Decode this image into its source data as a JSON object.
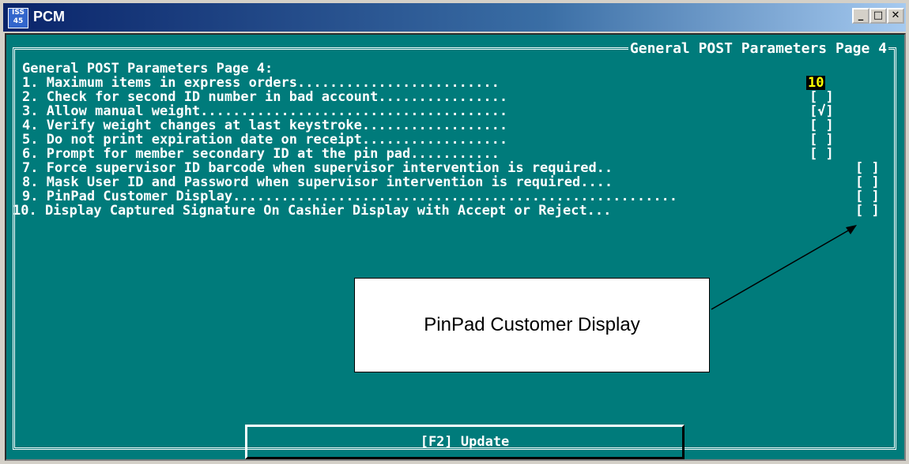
{
  "window": {
    "title": "PCM",
    "icon_text": "ISS\n45"
  },
  "title_buttons": {
    "minimize": "_",
    "maximize": "□",
    "close": "✕"
  },
  "frame_title": "General POST Parameters Page 4",
  "page_heading": "General POST Parameters Page 4:",
  "rows": [
    {
      "text": "1. Maximum items in express orders.........................",
      "value": "10"
    },
    {
      "text": "2. Check for second ID number in bad account................",
      "value": "[ ]"
    },
    {
      "text": "3. Allow manual weight......................................",
      "value": "[√]"
    },
    {
      "text": "4. Verify weight changes at last keystroke..................",
      "value": "[ ]"
    },
    {
      "text": "5. Do not print expiration date on receipt..................",
      "value": "[ ]"
    },
    {
      "text": "6. Prompt for member secondary ID at the pin pad...........",
      "value": "[ ]"
    },
    {
      "text": "7. Force supervisor ID barcode when supervisor intervention is required..",
      "value": "[ ]"
    },
    {
      "text": "8. Mask User ID and Password when supervisor intervention is required....",
      "value": "[ ]"
    },
    {
      "text": "9. PinPad Customer Display.......................................................",
      "value": "[ ]"
    },
    {
      "text": "10. Display Captured Signature On Cashier Display with Accept or Reject...",
      "value": "[ ]"
    }
  ],
  "update_button": "[F2] Update",
  "callout": "PinPad Customer Display"
}
